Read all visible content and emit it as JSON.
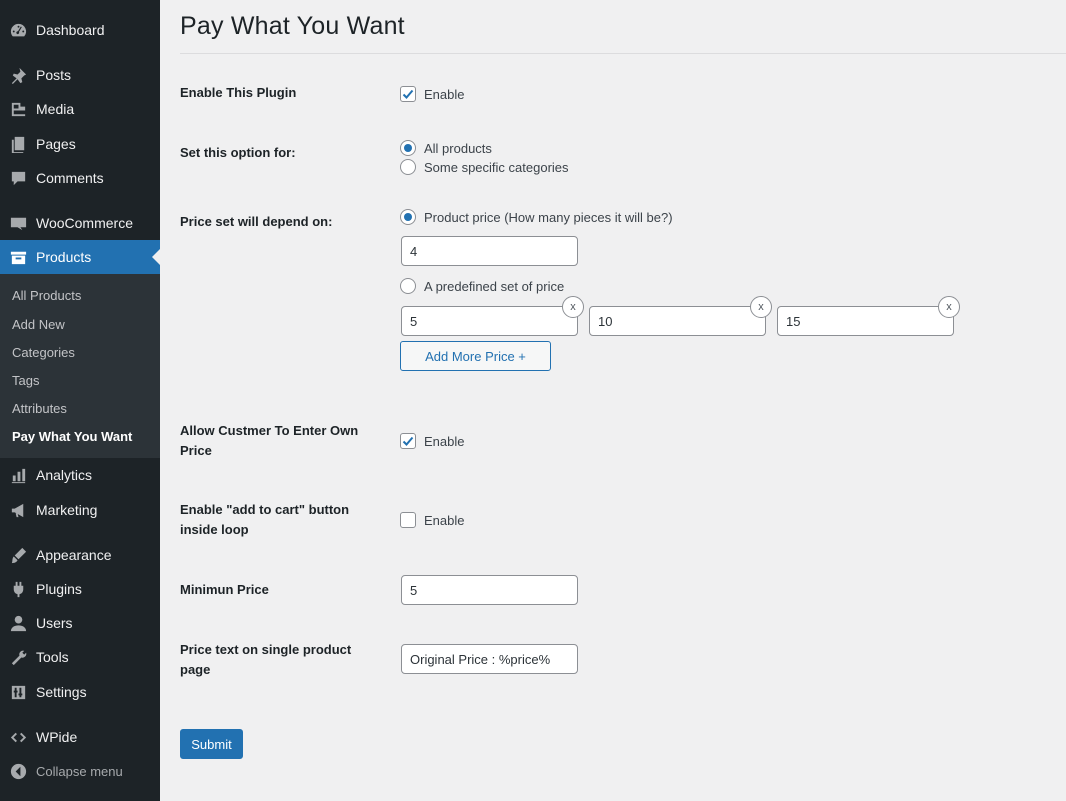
{
  "sidebar": {
    "items": [
      {
        "label": "Dashboard",
        "icon": "dashboard-icon"
      },
      {
        "label": "Posts",
        "icon": "pin-icon"
      },
      {
        "label": "Media",
        "icon": "media-icon"
      },
      {
        "label": "Pages",
        "icon": "pages-icon"
      },
      {
        "label": "Comments",
        "icon": "comment-icon"
      },
      {
        "label": "WooCommerce",
        "icon": "woo-icon"
      },
      {
        "label": "Products",
        "icon": "archive-icon"
      },
      {
        "label": "Analytics",
        "icon": "bar-chart-icon"
      },
      {
        "label": "Marketing",
        "icon": "megaphone-icon"
      },
      {
        "label": "Appearance",
        "icon": "paintbrush-icon"
      },
      {
        "label": "Plugins",
        "icon": "plugin-icon"
      },
      {
        "label": "Users",
        "icon": "user-icon"
      },
      {
        "label": "Tools",
        "icon": "wrench-icon"
      },
      {
        "label": "Settings",
        "icon": "settings-icon"
      },
      {
        "label": "WPide",
        "icon": "code-icon"
      }
    ],
    "submenu": [
      "All Products",
      "Add New",
      "Categories",
      "Tags",
      "Attributes",
      "Pay What You Want"
    ],
    "collapse_label": "Collapse menu",
    "accent": "#2271b1"
  },
  "page": {
    "title": "Pay What You Want"
  },
  "form": {
    "enable_plugin": {
      "label": "Enable This Plugin",
      "option": "Enable",
      "checked": true
    },
    "set_option_for": {
      "label": "Set this option for:",
      "options": [
        "All products",
        "Some specific categories"
      ],
      "selected": "All products"
    },
    "price_depend": {
      "label": "Price set will depend on:",
      "option_product_price": "Product price (How many pieces it will be?)",
      "pieces_value": "4",
      "option_predefined": "A predefined set of price",
      "predefined_values": [
        "5",
        "10",
        "15"
      ],
      "remove_label": "x",
      "add_more_label": "Add More Price +",
      "selected": "Product price (How many pieces it will be?)"
    },
    "allow_own_price": {
      "label": "Allow Custmer To Enter Own Price",
      "option": "Enable",
      "checked": true
    },
    "add_to_cart_loop": {
      "label": "Enable \"add to cart\" button inside loop",
      "option": "Enable",
      "checked": false
    },
    "minimum_price": {
      "label": "Minimun Price",
      "value": "5"
    },
    "price_text": {
      "label": "Price text on single product page",
      "value": "Original Price : %price%"
    },
    "submit_label": "Submit"
  }
}
